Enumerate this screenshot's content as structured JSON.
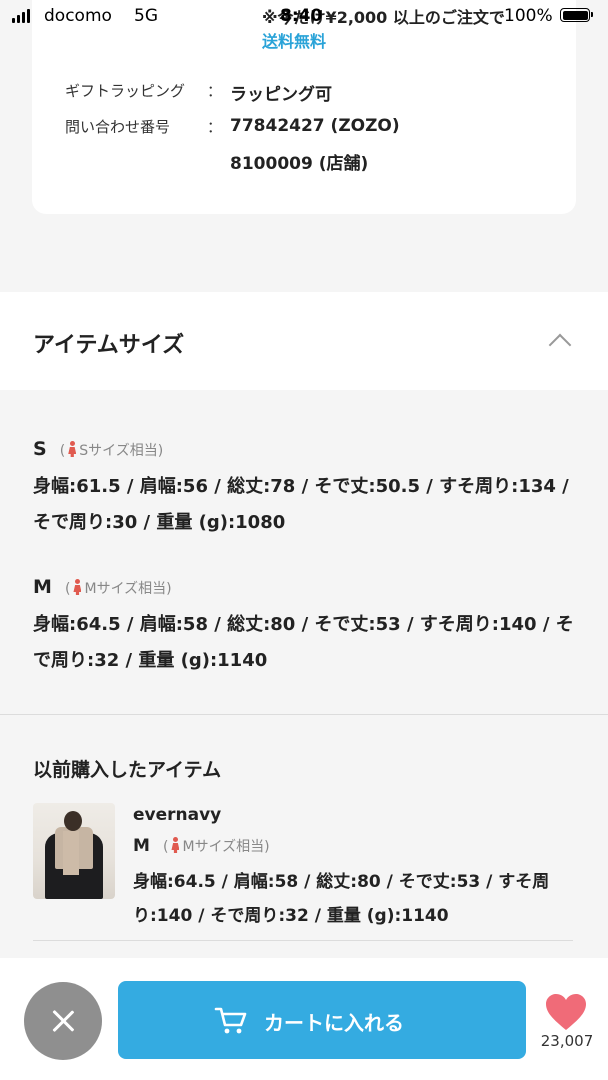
{
  "status_bar": {
    "carrier": "docomo",
    "network": "5G",
    "time": "8:40",
    "battery_percent": "100%"
  },
  "product_info": {
    "shipping_note": "※今だけ¥2,000 以上のご注文で",
    "shipping_free": "送料無料",
    "specs": [
      {
        "label": "ギフトラッピング",
        "colon": "：",
        "value": "ラッピング可"
      },
      {
        "label": "問い合わせ番号",
        "colon": "：",
        "value": "77842427 (ZOZO)"
      },
      {
        "label": "",
        "colon": "",
        "value": "8100009 (店舗)"
      }
    ]
  },
  "item_size": {
    "title": "アイテムサイズ",
    "sizes": [
      {
        "name": "S",
        "paren_open": "(",
        "equivalent": "Sサイズ相当",
        "paren_close": ")",
        "measurements": "身幅:61.5 / 肩幅:56 / 総丈:78 / そで丈:50.5 / すそ周り:134 / そで周り:30 / 重量 (g):1080"
      },
      {
        "name": "M",
        "paren_open": "(",
        "equivalent": "Mサイズ相当",
        "paren_close": ")",
        "measurements": "身幅:64.5 / 肩幅:58 / 総丈:80 / そで丈:53 / すそ周り:140 / そで周り:32 / 重量 (g):1140"
      }
    ]
  },
  "previous_purchase": {
    "title": "以前購入したアイテム",
    "brand": "evernavy",
    "size_name": "M",
    "paren_open": "(",
    "equivalent": "Mサイズ相当",
    "paren_close": ")",
    "measurements": "身幅:64.5 / 肩幅:58 / 総丈:80 / そで丈:53 / すそ周り:140 / そで周り:32 / 重量 (g):1140"
  },
  "bottom_bar": {
    "cart_label": "カートに入れる",
    "favorite_count": "23,007"
  },
  "colors": {
    "accent": "#34abe1",
    "free_shipping": "#2aa3d8",
    "heart": "#f06b78",
    "person_icon": "#e05a4f"
  },
  "icons": [
    "signal-icon",
    "battery-icon",
    "chevron-up-icon",
    "person-icon",
    "close-icon",
    "cart-icon",
    "heart-icon"
  ]
}
